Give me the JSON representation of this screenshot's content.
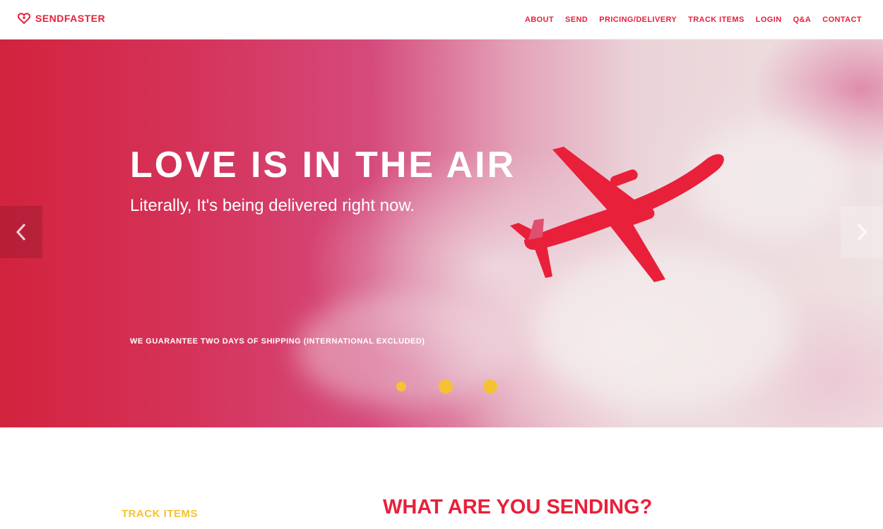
{
  "brand": {
    "name": "SENDFASTER",
    "icon": "heart-icon",
    "color": "#e8203a"
  },
  "nav": {
    "items": [
      {
        "label": "ABOUT"
      },
      {
        "label": "SEND"
      },
      {
        "label": "PRICING/DELIVERY"
      },
      {
        "label": "TRACK ITEMS"
      },
      {
        "label": "LOGIN"
      },
      {
        "label": "Q&A"
      },
      {
        "label": "CONTACT"
      }
    ]
  },
  "hero": {
    "title": "LOVE IS IN THE AIR",
    "subtitle": "Literally, It's being delivered right now.",
    "note": "WE GUARANTEE TWO DAYS OF SHIPPING (INTERNATIONAL EXCLUDED)",
    "prev_icon": "chevron-left-icon",
    "next_icon": "chevron-right-icon",
    "slide_count": 3,
    "active_slide": 1,
    "colors": {
      "primary": "#d2233e",
      "plane": "#e8203a",
      "indicator": "#f5c234"
    }
  },
  "sections": {
    "track_label": "TRACK ITEMS",
    "sending_heading": "WHAT ARE YOU SENDING?",
    "accent": "#f5c234"
  }
}
